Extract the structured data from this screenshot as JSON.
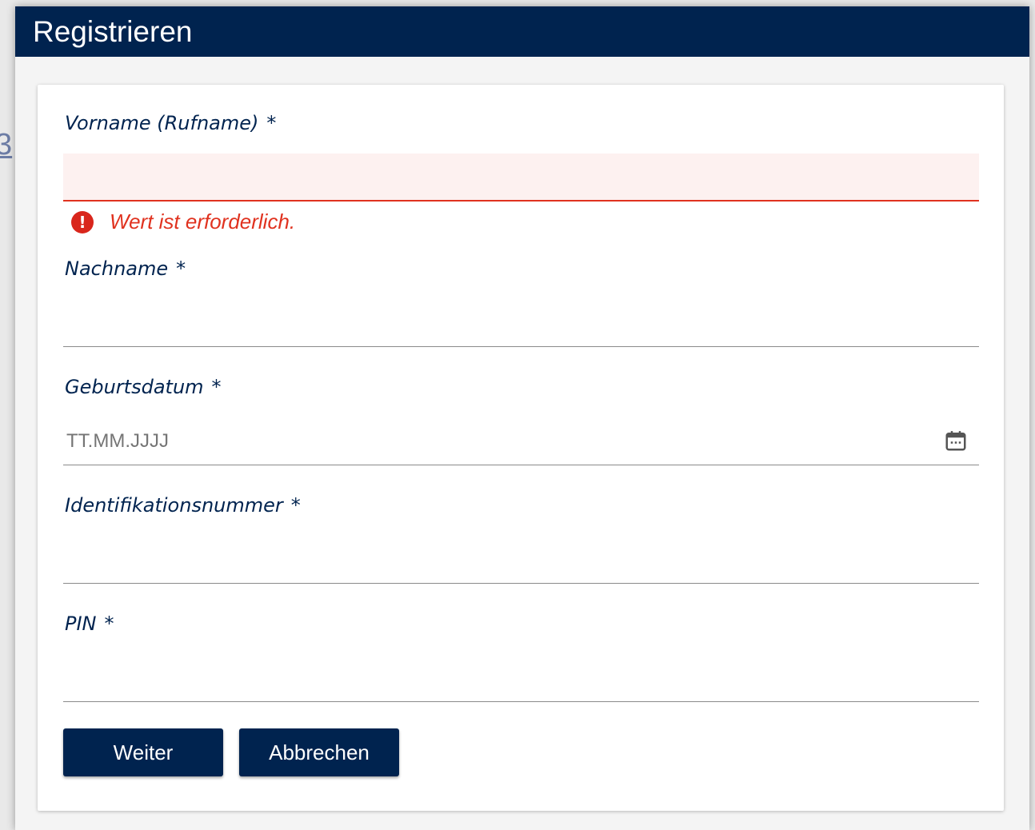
{
  "background_fragment": "3",
  "dialog": {
    "title": "Registrieren"
  },
  "form": {
    "fields": [
      {
        "label": "Vorname (Rufname)",
        "required_marker": "*",
        "value": "",
        "error": "Wert ist erforderlich."
      },
      {
        "label": "Nachname",
        "required_marker": "*",
        "value": ""
      },
      {
        "label": "Geburtsdatum",
        "required_marker": "*",
        "value": "",
        "placeholder": "TT.MM.JJJJ",
        "icon": "calendar-icon"
      },
      {
        "label": "Identifikationsnummer",
        "required_marker": "*",
        "value": ""
      },
      {
        "label": "PIN",
        "required_marker": "*",
        "value": ""
      }
    ],
    "buttons": {
      "next_label": "Weiter",
      "cancel_label": "Abbrechen"
    }
  },
  "colors": {
    "primary": "#00234f",
    "error": "#e0321f",
    "error_background": "#fdf1f0"
  }
}
